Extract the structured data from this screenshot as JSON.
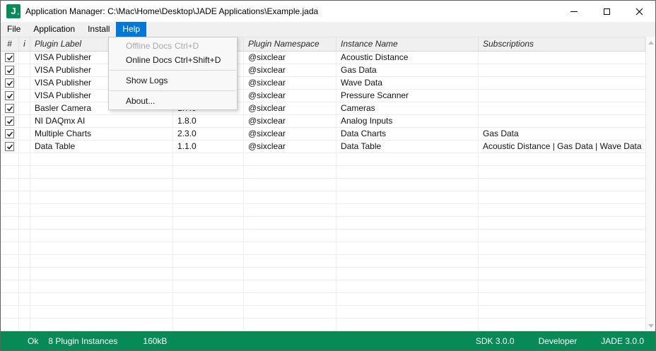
{
  "window": {
    "title": "Application Manager: C:\\Mac\\Home\\Desktop\\JADE Applications\\Example.jada",
    "icon_letter": "J",
    "icon_sub_mark": ","
  },
  "colors": {
    "brand_green": "#0a8a56",
    "status_green": "#088a57",
    "menu_highlight_blue": "#0078d7"
  },
  "menubar": {
    "items": [
      {
        "label": "File"
      },
      {
        "label": "Application"
      },
      {
        "label": "Install"
      },
      {
        "label": "Help",
        "active": true
      }
    ]
  },
  "help_menu": {
    "items": [
      {
        "label": "Offline Docs",
        "shortcut": "Ctrl+D",
        "disabled": true
      },
      {
        "label": "Online Docs",
        "shortcut": "Ctrl+Shift+D",
        "disabled": false
      },
      {
        "label": "Show Logs",
        "shortcut": "",
        "disabled": false
      },
      {
        "label": "About...",
        "shortcut": "",
        "disabled": false
      }
    ]
  },
  "table": {
    "header": {
      "num": "#",
      "info": "i",
      "plugin_label": "Plugin Label",
      "version": "",
      "namespace": "Plugin Namespace",
      "instance_name": "Instance Name",
      "subscriptions": "Subscriptions"
    },
    "rows": [
      {
        "checked": true,
        "plugin_label": "VISA Publisher",
        "version": "",
        "namespace": "@sixclear",
        "instance_name": "Acoustic Distance",
        "subscriptions": ""
      },
      {
        "checked": true,
        "plugin_label": "VISA Publisher",
        "version": "",
        "namespace": "@sixclear",
        "instance_name": "Gas Data",
        "subscriptions": ""
      },
      {
        "checked": true,
        "plugin_label": "VISA Publisher",
        "version": "",
        "namespace": "@sixclear",
        "instance_name": "Wave Data",
        "subscriptions": ""
      },
      {
        "checked": true,
        "plugin_label": "VISA Publisher",
        "version": "",
        "namespace": "@sixclear",
        "instance_name": "Pressure Scanner",
        "subscriptions": ""
      },
      {
        "checked": true,
        "plugin_label": "Basler Camera",
        "version": "1.7.0",
        "namespace": "@sixclear",
        "instance_name": "Cameras",
        "subscriptions": ""
      },
      {
        "checked": true,
        "plugin_label": "NI DAQmx AI",
        "version": "1.8.0",
        "namespace": "@sixclear",
        "instance_name": "Analog Inputs",
        "subscriptions": ""
      },
      {
        "checked": true,
        "plugin_label": "Multiple Charts",
        "version": "2.3.0",
        "namespace": "@sixclear",
        "instance_name": "Data Charts",
        "subscriptions": "Gas Data"
      },
      {
        "checked": true,
        "plugin_label": "Data Table",
        "version": "1.1.0",
        "namespace": "@sixclear",
        "instance_name": "Data Table",
        "subscriptions": "Acoustic Distance | Gas Data | Wave Data"
      }
    ]
  },
  "statusbar": {
    "status": "Ok",
    "instances": "8 Plugin Instances",
    "size": "160kB",
    "sdk": "SDK 3.0.0",
    "mode": "Developer",
    "version": "JADE 3.0.0"
  }
}
